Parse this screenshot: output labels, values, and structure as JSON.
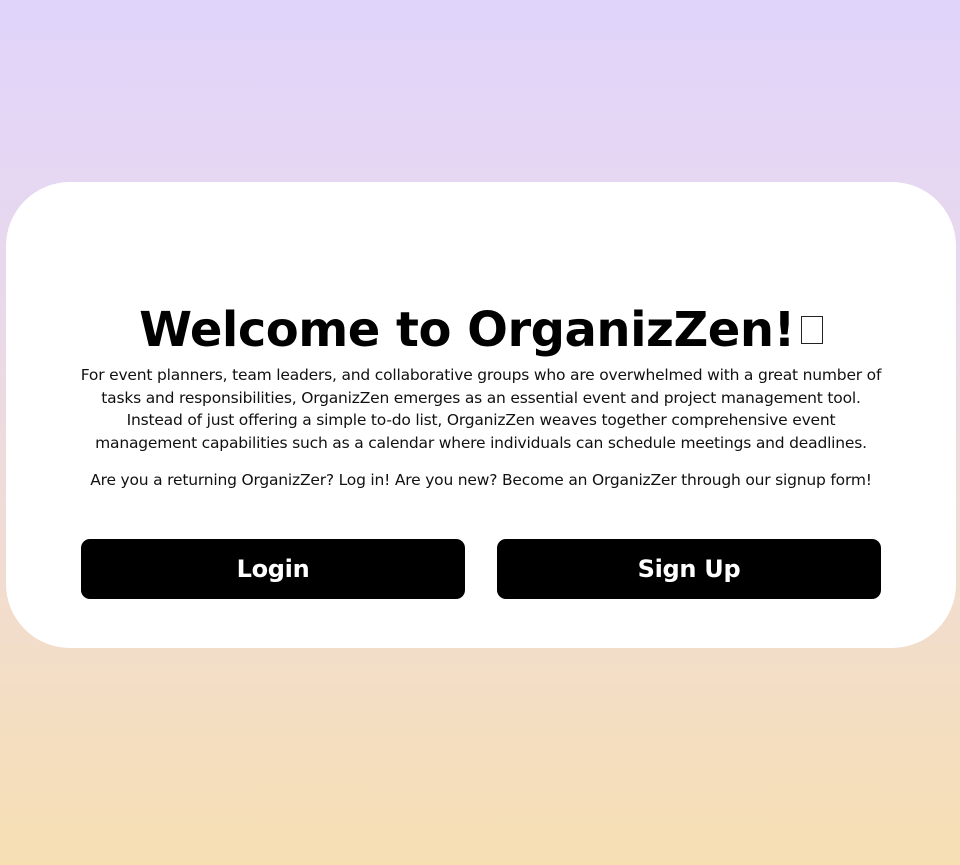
{
  "welcome": {
    "title": "Welcome to OrganizZen!",
    "description": "For event planners, team leaders, and collaborative groups who are overwhelmed with a great number of tasks and responsibilities, OrganizZen emerges as an essential event and project management tool. Instead of just offering a simple to-do list, OrganizZen weaves together comprehensive event management capabilities such as a calendar where individuals can schedule meetings and deadlines.",
    "prompt": "Are you a returning OrganizZer? Log in! Are you new? Become an OrganizZer through our signup form!"
  },
  "actions": {
    "login_label": "Login",
    "signup_label": "Sign Up"
  },
  "colors": {
    "background_top": "#e0d4fb",
    "background_bottom": "#f6dfb3",
    "card": "#ffffff",
    "button": "#000000",
    "button_text": "#ffffff"
  },
  "icons": {
    "title_trailing_glyph": "missing-glyph-box-icon"
  }
}
